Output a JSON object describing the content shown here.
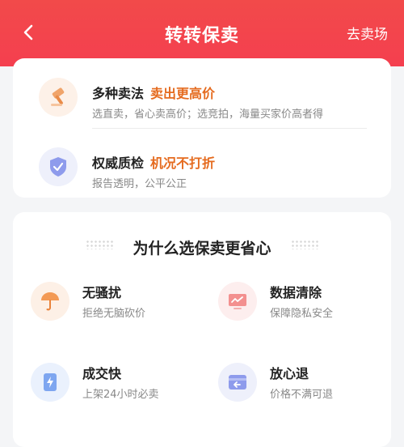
{
  "header": {
    "title": "转转保卖",
    "right_link": "去卖场"
  },
  "features": [
    {
      "title": "多种卖法",
      "highlight": "卖出更高价",
      "desc": "选直卖，省心卖高价；选竞拍，海量买家价高者得"
    },
    {
      "title": "权威质检",
      "highlight": "机况不打折",
      "desc": "报告透明，公平公正"
    }
  ],
  "why": {
    "title": "为什么选保卖更省心",
    "items": [
      {
        "title": "无骚扰",
        "desc": "拒绝无脑砍价",
        "icon": "umbrella-icon"
      },
      {
        "title": "数据清除",
        "desc": "保障隐私安全",
        "icon": "monitor-icon"
      },
      {
        "title": "成交快",
        "desc": "上架24小时必卖",
        "icon": "lightning-icon"
      },
      {
        "title": "放心退",
        "desc": "价格不满可退",
        "icon": "return-icon"
      }
    ]
  },
  "colors": {
    "header_red": "#f24a4a",
    "highlight_orange": "#e56b1f"
  }
}
